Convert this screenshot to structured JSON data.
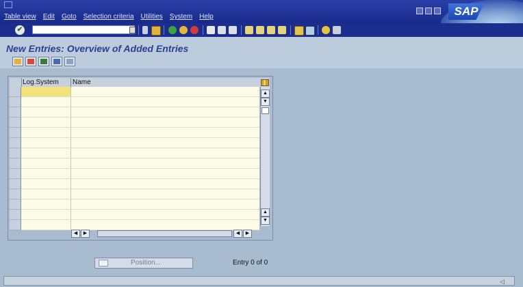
{
  "menubar": {
    "items": [
      "Table view",
      "Edit",
      "Goto",
      "Selection criteria",
      "Utilities",
      "System",
      "Help"
    ],
    "logo": "SAP"
  },
  "toolbar": {
    "ok_icon": "checkmark-icon",
    "command_field_value": ""
  },
  "title": "New Entries: Overview of Added Entries",
  "table": {
    "columns": [
      "Log.System",
      "Name"
    ],
    "rows": [
      [
        "",
        ""
      ],
      [
        "",
        ""
      ],
      [
        "",
        ""
      ],
      [
        "",
        ""
      ],
      [
        "",
        ""
      ],
      [
        "",
        ""
      ],
      [
        "",
        ""
      ],
      [
        "",
        ""
      ],
      [
        "",
        ""
      ],
      [
        "",
        ""
      ],
      [
        "",
        ""
      ],
      [
        "",
        ""
      ],
      [
        "",
        ""
      ],
      [
        "",
        ""
      ]
    ]
  },
  "position_button": {
    "label": "Position..."
  },
  "entry_info": "Entry 0 of 0",
  "colors": {
    "menubar": "#1b2e8e",
    "background": "#a9bccf",
    "title": "#2a3f8f",
    "cell": "#fbfbe7",
    "active_cell": "#f3e27a"
  }
}
